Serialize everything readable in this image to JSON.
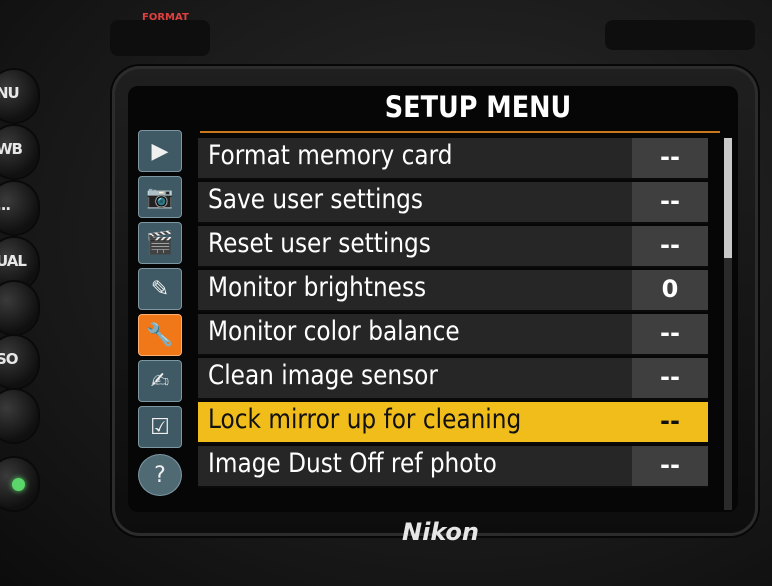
{
  "hardware": {
    "format_tag": "FORMAT",
    "brand": "Nikon",
    "side_buttons": [
      "NU",
      "WB",
      "...",
      "UAL",
      "",
      "SO",
      "",
      ""
    ]
  },
  "screen": {
    "title": "SETUP MENU",
    "tabs": [
      {
        "name": "playback-tab-icon",
        "glyph": "▶"
      },
      {
        "name": "camera-tab-icon",
        "glyph": "📷"
      },
      {
        "name": "movie-tab-icon",
        "glyph": "🎬"
      },
      {
        "name": "custom-settings-tab-icon",
        "glyph": "✎"
      },
      {
        "name": "setup-tab-icon",
        "glyph": "🔧"
      },
      {
        "name": "retouch-tab-icon",
        "glyph": "✍"
      },
      {
        "name": "my-menu-tab-icon",
        "glyph": "☑"
      },
      {
        "name": "help-icon",
        "glyph": "?"
      }
    ],
    "items": [
      {
        "label": "Format memory card",
        "value": "--"
      },
      {
        "label": "Save user settings",
        "value": "--"
      },
      {
        "label": "Reset user settings",
        "value": "--"
      },
      {
        "label": "Monitor brightness",
        "value": "0"
      },
      {
        "label": "Monitor color balance",
        "value": "--"
      },
      {
        "label": "Clean image sensor",
        "value": "--"
      },
      {
        "label": "Lock mirror up for cleaning",
        "value": "--"
      },
      {
        "label": "Image Dust Off ref photo",
        "value": "--"
      }
    ],
    "selected_index": 6,
    "colors": {
      "accent": "#f07818",
      "selection": "#f1bd1a",
      "tab_bg": "#3f5a64"
    }
  }
}
